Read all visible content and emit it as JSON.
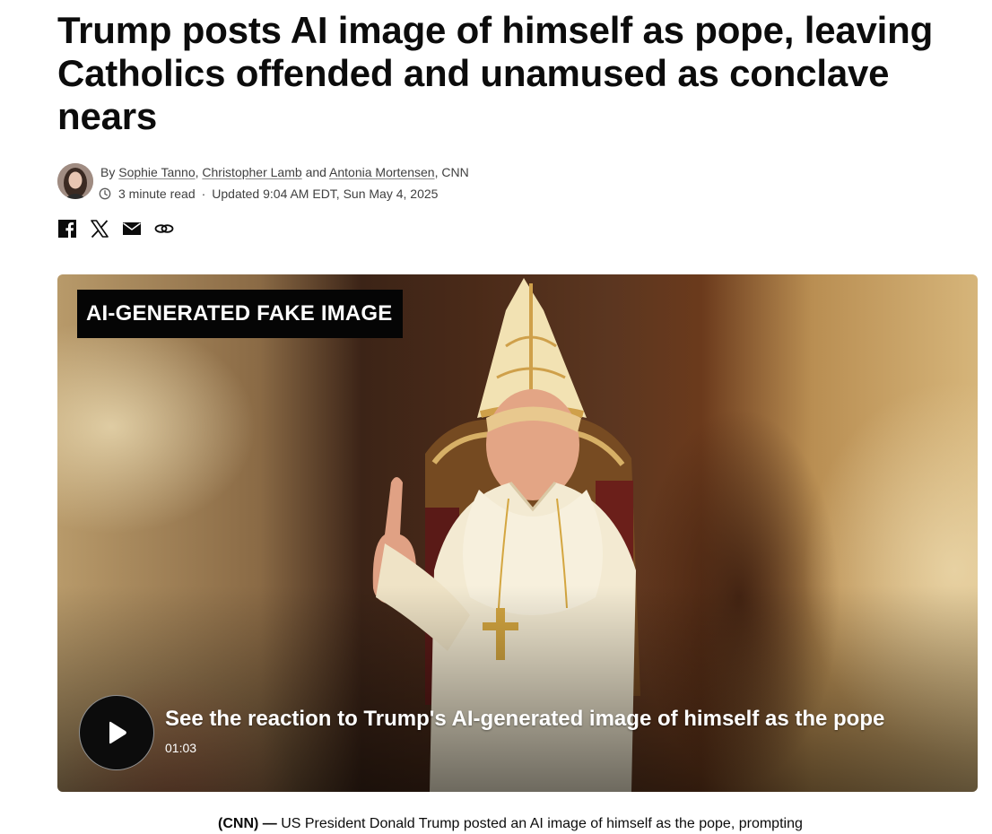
{
  "headline": "Trump posts AI image of himself as pope, leaving Catholics offended and unamused as conclave nears",
  "byline": {
    "prefix": "By",
    "authors": [
      "Sophie Tanno",
      "Christopher Lamb",
      "Antonia Mortensen"
    ],
    "sep1": ",",
    "sep2": "and",
    "outlet": ", CNN"
  },
  "meta": {
    "read_time": "3 minute read",
    "separator": "·",
    "updated": "Updated 9:04 AM EDT, Sun May 4, 2025"
  },
  "share_icons": [
    "facebook-icon",
    "x-icon",
    "email-icon",
    "link-icon"
  ],
  "video": {
    "overlay_label": "AI-GENERATED FAKE IMAGE",
    "title": "See the reaction to Trump's AI-generated image of himself as the pope",
    "duration": "01:03"
  },
  "article": {
    "source": "(CNN) —",
    "first_line": " US President Donald Trump posted an AI image of himself as the pope, prompting"
  }
}
